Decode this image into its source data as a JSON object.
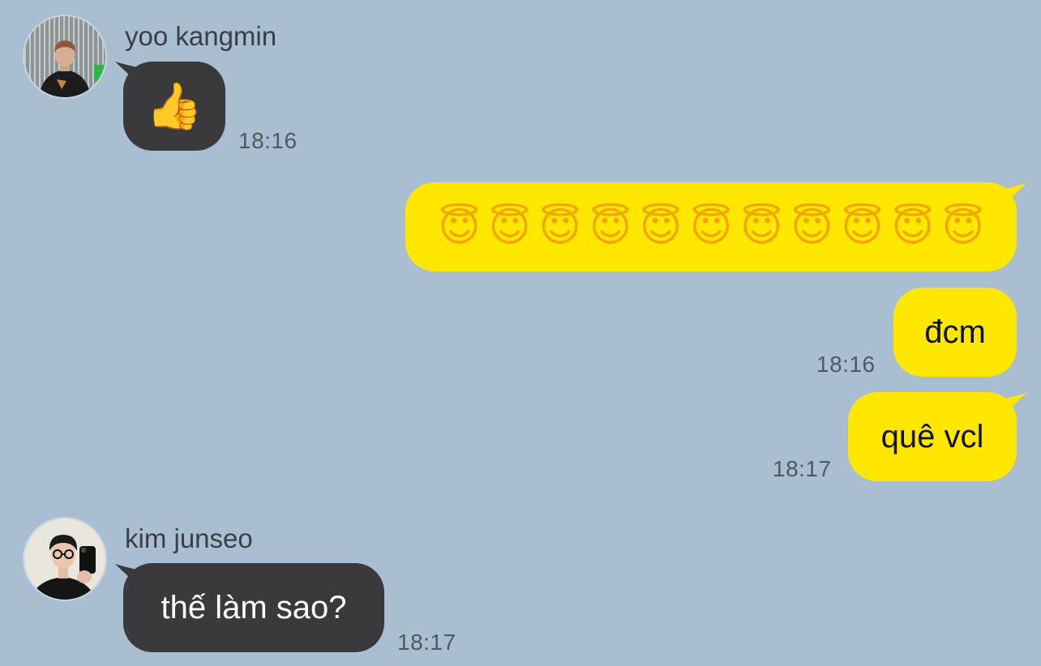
{
  "colors": {
    "background": "#a9bfd1",
    "incoming_bubble": "#3a393b",
    "outgoing_bubble": "#ffe700",
    "timestamp": "#4f5963"
  },
  "messages": [
    {
      "sender": "yoo kangmin",
      "avatar": "avatar-yoo-kangmin",
      "direction": "incoming",
      "icon": "thumbs-up-emoji",
      "time": "18:16"
    },
    {
      "direction": "outgoing",
      "icon": "smiling-face-with-halo-emoji",
      "emoji_count": 11
    },
    {
      "direction": "outgoing",
      "text": "đcm",
      "time": "18:16"
    },
    {
      "direction": "outgoing",
      "text": "quê vcl",
      "time": "18:17"
    },
    {
      "sender": "kim junseo",
      "avatar": "avatar-kim-junseo",
      "direction": "incoming",
      "text": "thế làm sao?",
      "time": "18:17"
    }
  ]
}
